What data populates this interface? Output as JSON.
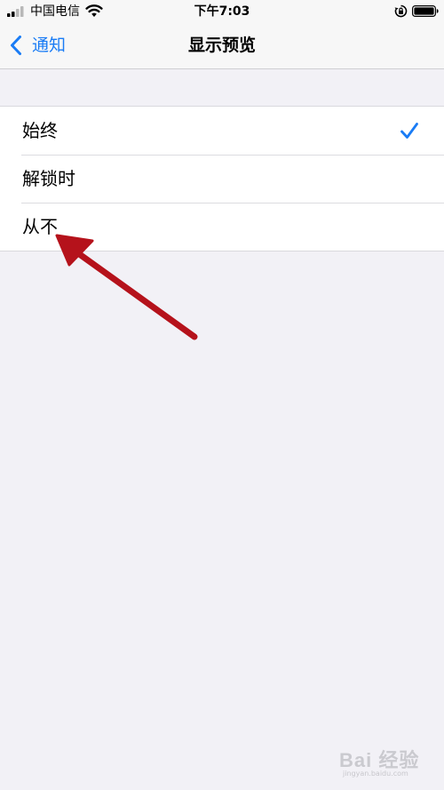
{
  "status_bar": {
    "carrier": "中国电信",
    "time": "下午7:03"
  },
  "nav": {
    "back_label": "通知",
    "title": "显示预览"
  },
  "options": [
    {
      "label": "始终",
      "selected": true
    },
    {
      "label": "解锁时",
      "selected": false
    },
    {
      "label": "从不",
      "selected": false
    }
  ],
  "icons": {
    "signal": "signal-bars-icon",
    "wifi": "wifi-icon",
    "rotation_lock": "rotation-lock-icon",
    "battery": "battery-icon",
    "back": "chevron-left-icon",
    "check": "checkmark-icon",
    "annotation": "red-arrow-annotation"
  },
  "watermark": {
    "text": "Bai 经验",
    "url": "jingyan.baidu.com"
  },
  "colors": {
    "accent": "#1a7cf5",
    "background": "#f2f1f6",
    "annotation": "#b5121b"
  }
}
